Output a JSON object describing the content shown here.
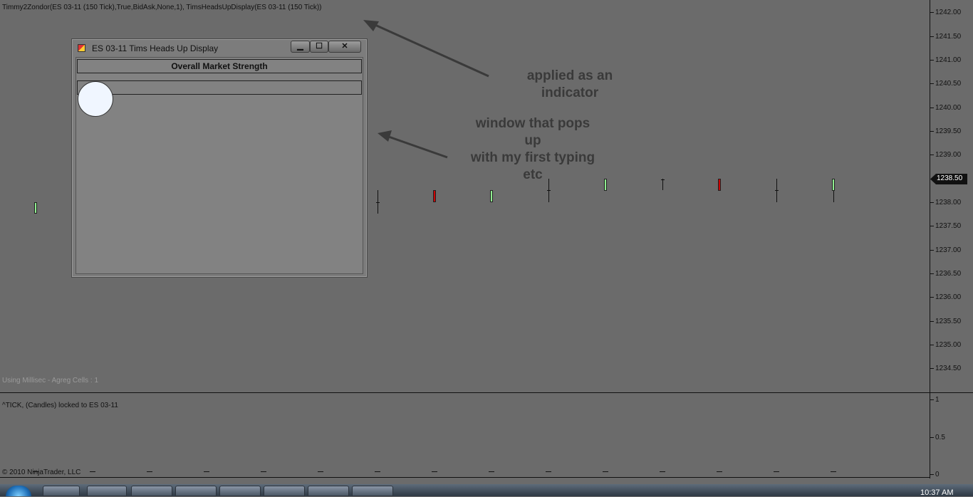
{
  "chart": {
    "header_text": "Timmy2Zondor(ES 03-11 (150 Tick),True,BidAsk,None,1), TimsHeadsUpDisplay(ES 03-11 (150 Tick))",
    "status_text": "Using Millisec - Agreg Cells : 1",
    "price_levels": [
      "1242.00",
      "1241.50",
      "1241.00",
      "1240.50",
      "1240.00",
      "1239.50",
      "1239.00",
      "1238.50",
      "1238.00",
      "1237.50",
      "1237.00",
      "1236.50",
      "1236.00",
      "1235.50",
      "1235.00",
      "1234.50"
    ],
    "current_price": "1238.50",
    "colors": {
      "background": "#6b6b6b",
      "up_candle": "#90ee90",
      "down_candle": "#cc0000",
      "price_marker": "#111111"
    }
  },
  "lower_panel": {
    "title": "^TICK, (Candles) locked to ES 03-11",
    "axis_labels": [
      "1",
      "0.5",
      "0"
    ],
    "copyright": "© 2010 NinjaTrader, LLC"
  },
  "popup_window": {
    "title": "ES 03-11   Tims Heads Up Display",
    "minimize_label": "▁",
    "maximize_label": "☐",
    "close_label": "✕",
    "header_label": "Overall Market Strength",
    "icon": "app-icon"
  },
  "annotations": {
    "indicator_note": [
      "applied as an",
      "indicator"
    ],
    "window_note": [
      "window that pops",
      "up",
      "with my first typing",
      "etc"
    ]
  },
  "taskbar": {
    "clock": "10:37 AM",
    "apps": [
      "start-orb",
      "explorer-icon",
      "firefox-icon",
      "app-icon",
      "media-icon",
      "skype-icon",
      "window-icon",
      "excel-icon",
      "paint-icon"
    ]
  }
}
